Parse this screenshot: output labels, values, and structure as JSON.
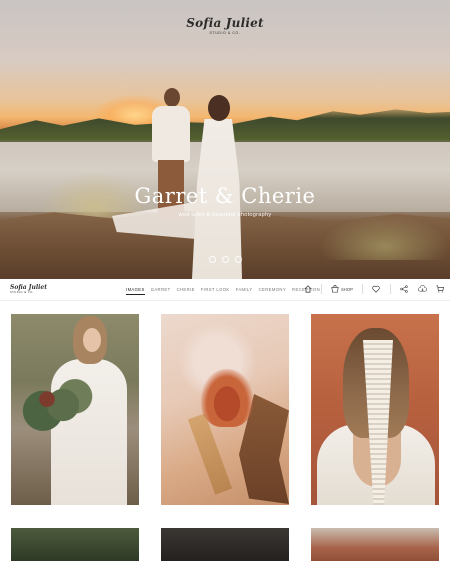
{
  "brand": {
    "name": "Sofia Juliet",
    "tagline": "STUDIO & CO."
  },
  "hero": {
    "title": "Garret & Cherie",
    "subtitle": "wed tales & beautiful photography"
  },
  "nav": {
    "links": [
      {
        "label": "IMAGES",
        "active": true
      },
      {
        "label": "GARRET",
        "active": false
      },
      {
        "label": "CHERIE",
        "active": false
      },
      {
        "label": "FIRST LOOK",
        "active": false
      },
      {
        "label": "FAMILY",
        "active": false
      },
      {
        "label": "CEREMONY",
        "active": false
      },
      {
        "label": "RECEPTION",
        "active": false
      }
    ],
    "shop_label": "SHOP",
    "icons": [
      "home-icon",
      "shop-icon",
      "heart-icon",
      "share-icon",
      "download-icon",
      "cart-icon",
      "help-icon"
    ]
  },
  "gallery": {
    "tiles": [
      "bride-with-bouquet",
      "protea-flowers",
      "bride-back-macrame",
      "greenery",
      "dark-lace",
      "desert-landscape"
    ]
  },
  "colors": {
    "text": "#222222",
    "muted": "#777777",
    "hero_text": "#ffffff"
  }
}
